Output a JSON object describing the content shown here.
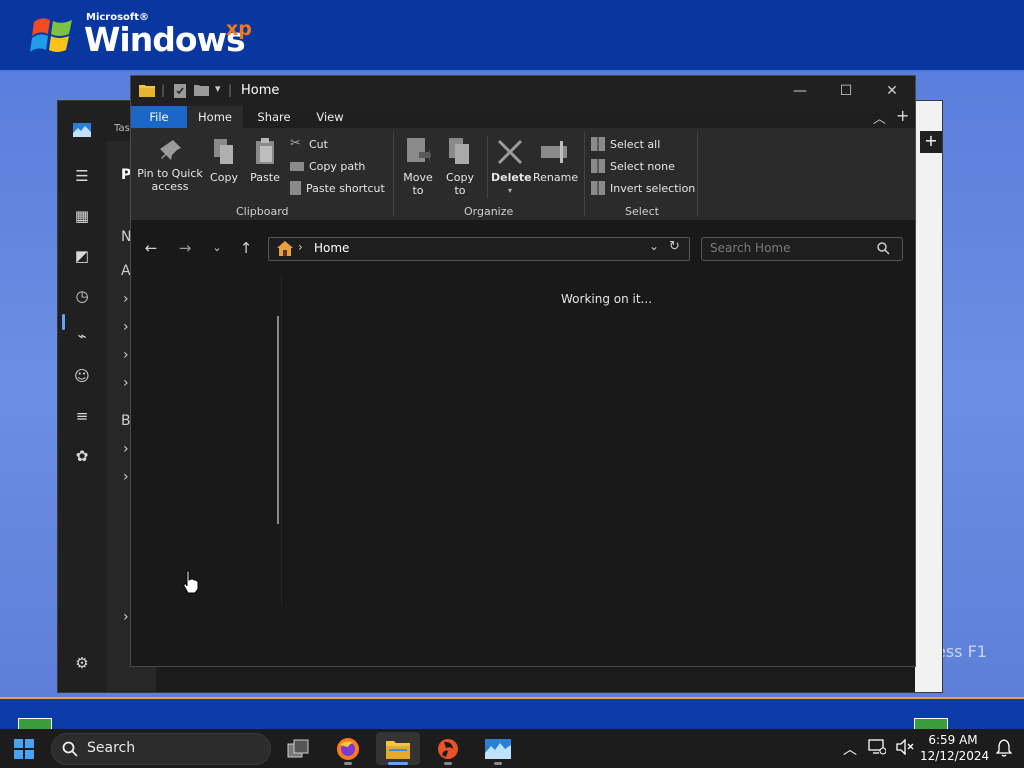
{
  "desktop": {
    "logo_brand": "Microsoft®",
    "logo_name": "Windows",
    "logo_edition": "xp",
    "help_text": "ess F1"
  },
  "background_app": {
    "tab_label": "Tas",
    "pane_heading": "P",
    "pane_letters": [
      "N",
      "A",
      "B"
    ]
  },
  "explorer": {
    "title": "Home",
    "tabs": [
      {
        "label": "File"
      },
      {
        "label": "Home"
      },
      {
        "label": "Share"
      },
      {
        "label": "View"
      }
    ],
    "clipboard": {
      "pin_label_1": "Pin to Quick",
      "pin_label_2": "access",
      "copy": "Copy",
      "paste": "Paste",
      "cut": "Cut",
      "copy_path": "Copy path",
      "paste_shortcut": "Paste shortcut",
      "group": "Clipboard"
    },
    "organize": {
      "move_1": "Move",
      "move_2": "to",
      "copyto_1": "Copy",
      "copyto_2": "to",
      "delete": "Delete",
      "rename": "Rename",
      "group": "Organize"
    },
    "select": {
      "select_all": "Select all",
      "select_none": "Select none",
      "invert": "Invert selection",
      "group": "Select"
    },
    "address": {
      "location": "Home",
      "search_placeholder": "Search Home"
    },
    "status_text": "Working on it..."
  },
  "taskbar": {
    "search_label": "Search",
    "time": "6:59 AM",
    "date": "12/12/2024"
  },
  "colors": {
    "accent": "#1a66c9",
    "xp_blue": "#2450b8",
    "dark_bg": "#191919"
  }
}
